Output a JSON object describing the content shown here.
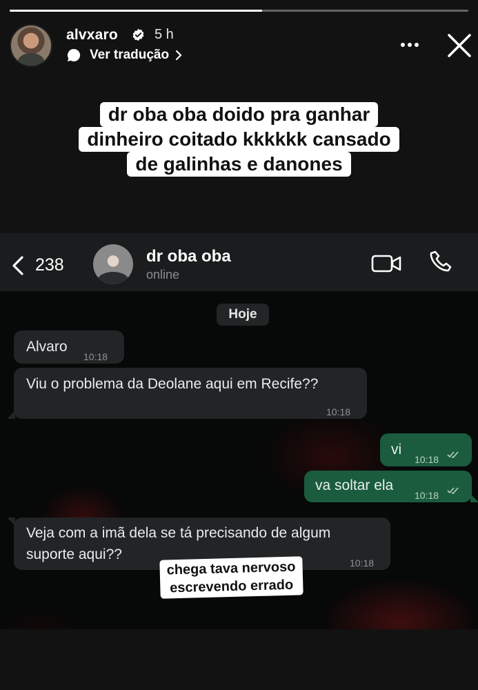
{
  "story": {
    "progress": 0.55,
    "username": "alvxaro",
    "time_ago": "5 h",
    "translate_label": "Ver tradução",
    "caption_lines": [
      "dr oba oba doido pra ganhar",
      "dinheiro coitado kkkkkk cansado",
      "de galinhas e danones"
    ],
    "sticker_lines": [
      "chega tava nervoso",
      "escrevendo errado"
    ]
  },
  "chat": {
    "unread_count": "238",
    "contact_name": "dr oba oba",
    "contact_status": "online",
    "date_chip": "Hoje",
    "messages": [
      {
        "direction": "in",
        "text": "Alvaro",
        "time": "10:18"
      },
      {
        "direction": "in",
        "text": "Viu o problema da Deolane aqui em Recife??",
        "time": "10:18"
      },
      {
        "direction": "out",
        "text": "vi",
        "time": "10:18"
      },
      {
        "direction": "out",
        "text": "va soltar ela",
        "time": "10:18"
      },
      {
        "direction": "in",
        "text_lines": [
          "Veja com a imã dela se tá precisando de algum",
          "suporte aqui??"
        ],
        "time": "10:18"
      }
    ]
  },
  "colors": {
    "incoming_bubble": "#222426",
    "outgoing_bubble": "#1a5c3d",
    "background": "#121212"
  }
}
